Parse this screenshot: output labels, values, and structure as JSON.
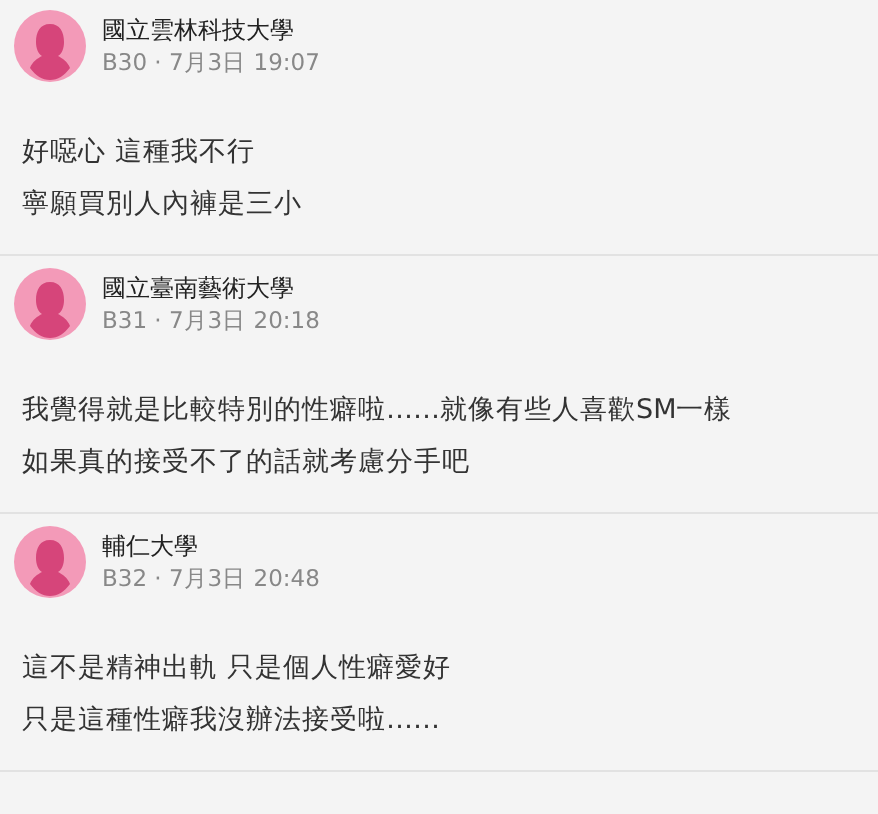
{
  "comments": [
    {
      "school": "國立雲林科技大學",
      "meta": "B30 · 7月3日 19:07",
      "lines": [
        "好噁心 這種我不行",
        "寧願買別人內褲是三小"
      ]
    },
    {
      "school": "國立臺南藝術大學",
      "meta": "B31 · 7月3日 20:18",
      "lines": [
        "我覺得就是比較特別的性癖啦……就像有些人喜歡SM一樣",
        "如果真的接受不了的話就考慮分手吧"
      ]
    },
    {
      "school": "輔仁大學",
      "meta": "B32 · 7月3日 20:48",
      "lines": [
        "這不是精神出軌 只是個人性癖愛好",
        "只是這種性癖我沒辦法接受啦……"
      ]
    }
  ]
}
